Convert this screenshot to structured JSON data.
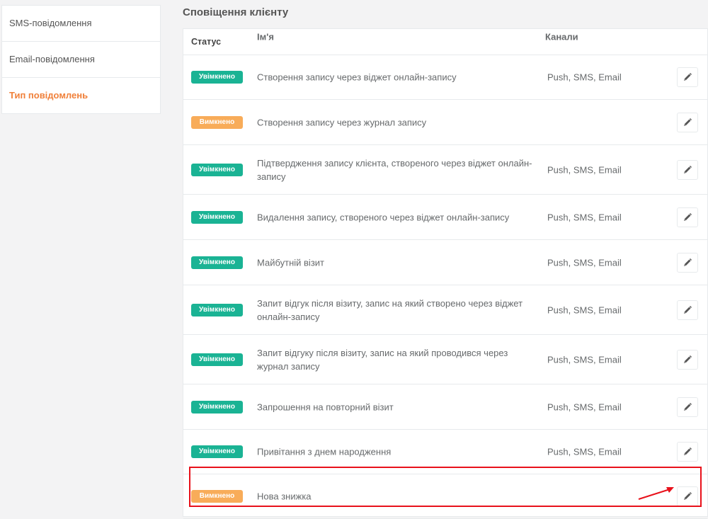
{
  "sidebar": {
    "items": [
      {
        "label": "SMS-повідомлення"
      },
      {
        "label": "Email-повідомлення"
      },
      {
        "label": "Тип повідомлень"
      }
    ]
  },
  "section": {
    "title": "Сповіщення клієнту"
  },
  "table": {
    "headers": {
      "status": "Статус",
      "name": "Ім'я",
      "channels": "Канали"
    },
    "rows": [
      {
        "status": "Увімкнено",
        "state": "on",
        "name": "Створення запису через віджет онлайн-запису",
        "channels": "Push, SMS, Email"
      },
      {
        "status": "Вимкнено",
        "state": "off",
        "name": "Створення запису через журнал запису",
        "channels": ""
      },
      {
        "status": "Увімкнено",
        "state": "on",
        "name": "Підтвердження запису клієнта, створеного через віджет онлайн-запису",
        "channels": "Push, SMS, Email"
      },
      {
        "status": "Увімкнено",
        "state": "on",
        "name": "Видалення запису, створеного через віджет онлайн-запису",
        "channels": "Push, SMS, Email"
      },
      {
        "status": "Увімкнено",
        "state": "on",
        "name": "Майбутній візит",
        "channels": "Push, SMS, Email"
      },
      {
        "status": "Увімкнено",
        "state": "on",
        "name": "Запит відгук після візиту, запис на який створено через віджет онлайн-запису",
        "channels": "Push, SMS, Email"
      },
      {
        "status": "Увімкнено",
        "state": "on",
        "name": "Запит відгуку після візиту, запис на який проводився через журнал запису",
        "channels": "Push, SMS, Email"
      },
      {
        "status": "Увімкнено",
        "state": "on",
        "name": "Запрошення на повторний візит",
        "channels": "Push, SMS, Email"
      },
      {
        "status": "Увімкнено",
        "state": "on",
        "name": "Привітання з днем народження",
        "channels": "Push, SMS, Email"
      },
      {
        "status": "Вимкнено",
        "state": "off",
        "name": "Нова знижка",
        "channels": ""
      }
    ]
  },
  "icons": {
    "edit": "pencil-icon"
  },
  "colors": {
    "enabled": "#1ab394",
    "disabled": "#f8ac59",
    "active_menu": "#f0803a",
    "annotation": "#e8111b"
  }
}
